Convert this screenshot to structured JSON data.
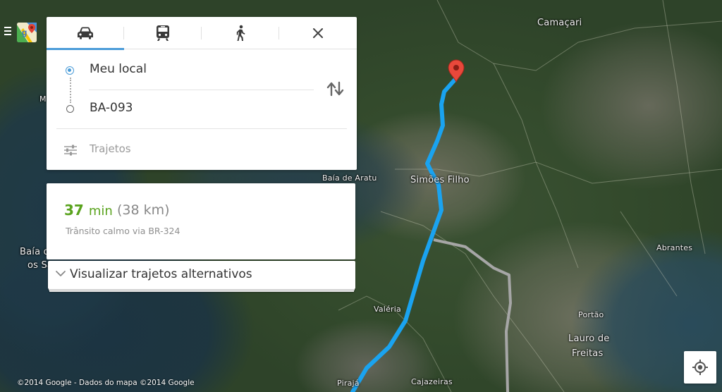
{
  "app": {
    "logo": "google-maps-icon",
    "menu": "menu-icon"
  },
  "directions": {
    "modes": [
      {
        "name": "car",
        "icon": "car-icon",
        "active": true
      },
      {
        "name": "transit",
        "icon": "train-icon",
        "active": false
      },
      {
        "name": "walking",
        "icon": "walking-icon",
        "active": false
      }
    ],
    "close_icon": "close-icon",
    "origin": "Meu local",
    "destination": "BA-093",
    "swap_icon": "swap-icon",
    "options_label": "Trajetos",
    "options_icon": "sliders-icon"
  },
  "route": {
    "time_value": "37",
    "time_unit": "min",
    "distance": "(38 km)",
    "summary": "Trânsito calmo via BR-324"
  },
  "alternatives": {
    "label": "Visualizar trajetos alternativos",
    "icon": "chevron-down-icon"
  },
  "map": {
    "places": {
      "camacari": "Camaçari",
      "simoes_filho": "Simões Filho",
      "baia_aratu": "Baía de Aratu",
      "baia_todos_santos_1": "Baía d",
      "baia_todos_santos_2": "os Sa",
      "abrantes": "Abrantes",
      "valeria": "Valéria",
      "portao": "Portão",
      "lauro_1": "Lauro de",
      "lauro_2": "Freitas",
      "piraja": "Pirajá",
      "cajazeiras": "Cajazeiras",
      "edge_m": "M"
    },
    "route_color": "#1aa3f0",
    "marker_color": "#e8483b",
    "locate_icon": "my-location-icon",
    "copyright": "©2014 Google - Dados do mapa ©2014 Google"
  }
}
